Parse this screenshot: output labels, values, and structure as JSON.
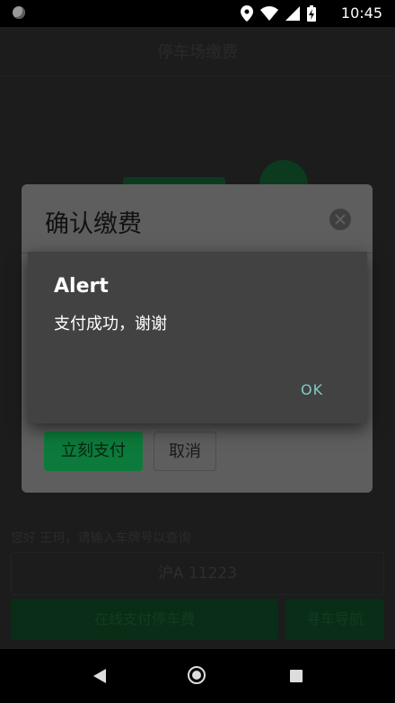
{
  "status_bar": {
    "time": "10:45",
    "icons": [
      "app-notification-icon",
      "location-icon",
      "wifi-icon",
      "signal-icon",
      "battery-icon"
    ]
  },
  "app": {
    "title": "停车场缴费",
    "hint": "您好 王珂，请输入车牌号以查询",
    "plate_value": "沪A 11223",
    "pay_online_label": "在线支付停车费",
    "find_car_label": "寻车导航"
  },
  "confirm_dialog": {
    "title": "确认缴费",
    "pay_now_label": "立刻支付",
    "cancel_label": "取消"
  },
  "alert": {
    "title": "Alert",
    "message": "支付成功，谢谢",
    "ok_label": "OK"
  },
  "colors": {
    "accent_green": "#0c7a3a",
    "ok_text": "#80cbc4",
    "alert_bg": "#424242"
  }
}
